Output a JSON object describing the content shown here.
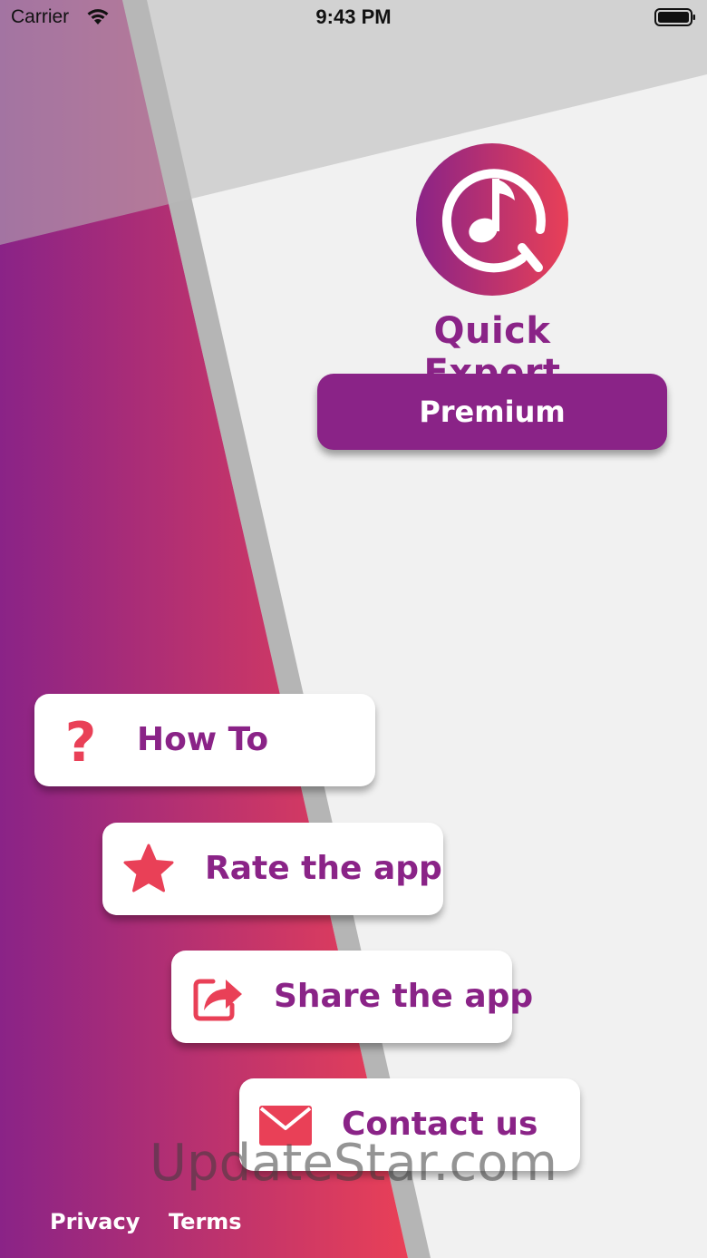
{
  "status_bar": {
    "carrier": "Carrier",
    "time": "9:43 PM"
  },
  "app": {
    "title": "Quick Export"
  },
  "premium_button": {
    "label": "Premium"
  },
  "menu": [
    {
      "label": "How To",
      "icon": "question-icon"
    },
    {
      "label": "Rate the app",
      "icon": "star-icon"
    },
    {
      "label": "Share the app",
      "icon": "share-icon"
    },
    {
      "label": "Contact us",
      "icon": "mail-icon"
    }
  ],
  "watermark": "UpdateStar.com",
  "footer": {
    "privacy": "Privacy",
    "terms": "Terms"
  },
  "colors": {
    "brand_purple": "#8a2387",
    "brand_pink": "#e94057",
    "background": "#f1f1f1",
    "stripe_gray": "#b5b5b5"
  }
}
